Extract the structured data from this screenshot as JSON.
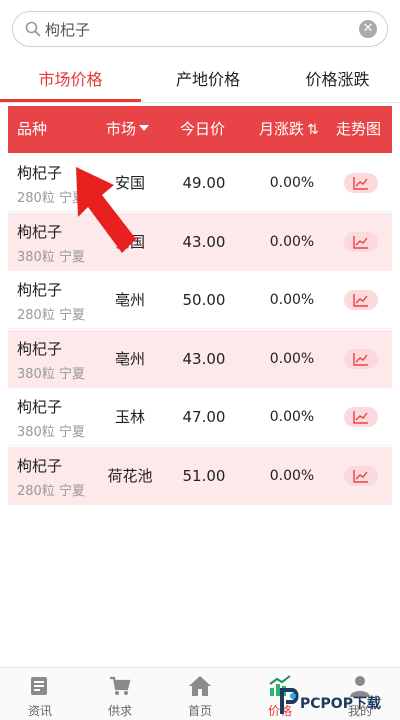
{
  "search": {
    "value": "枸杞子",
    "icon": "search-icon",
    "clear_icon": "close-icon",
    "clear_glyph": "✕"
  },
  "tabs": [
    {
      "label": "市场价格",
      "active": true
    },
    {
      "label": "产地价格",
      "active": false
    },
    {
      "label": "价格涨跌",
      "active": false
    }
  ],
  "table": {
    "headers": {
      "variety": "品种",
      "market": "市场",
      "today_price": "今日价",
      "monthly_change": "月涨跌",
      "trend": "走势图"
    },
    "rows": [
      {
        "name": "枸杞子",
        "spec": "280粒 宁夏",
        "market": "安国",
        "price": "49.00",
        "change": "0.00%"
      },
      {
        "name": "枸杞子",
        "spec": "380粒 宁夏",
        "market": "安国",
        "price": "43.00",
        "change": "0.00%"
      },
      {
        "name": "枸杞子",
        "spec": "280粒 宁夏",
        "market": "亳州",
        "price": "50.00",
        "change": "0.00%"
      },
      {
        "name": "枸杞子",
        "spec": "380粒 宁夏",
        "market": "亳州",
        "price": "43.00",
        "change": "0.00%"
      },
      {
        "name": "枸杞子",
        "spec": "380粒 宁夏",
        "market": "玉林",
        "price": "47.00",
        "change": "0.00%"
      },
      {
        "name": "枸杞子",
        "spec": "280粒 宁夏",
        "market": "荷花池",
        "price": "51.00",
        "change": "0.00%"
      }
    ]
  },
  "bottom_nav": [
    {
      "label": "资讯",
      "icon": "news-icon",
      "active": false
    },
    {
      "label": "供求",
      "icon": "cart-icon",
      "active": false
    },
    {
      "label": "首页",
      "icon": "home-icon",
      "active": false
    },
    {
      "label": "价格",
      "icon": "price-chart-icon",
      "active": true
    },
    {
      "label": "我的",
      "icon": "user-icon",
      "active": false
    }
  ],
  "watermark": {
    "text": "PCPOP下载"
  },
  "colors": {
    "accent": "#e53935",
    "header_bg": "#e84448",
    "even_row_bg": "#fde8ea",
    "trend_button_bg": "#fbd9dc",
    "annotation_arrow": "#e8201f"
  }
}
